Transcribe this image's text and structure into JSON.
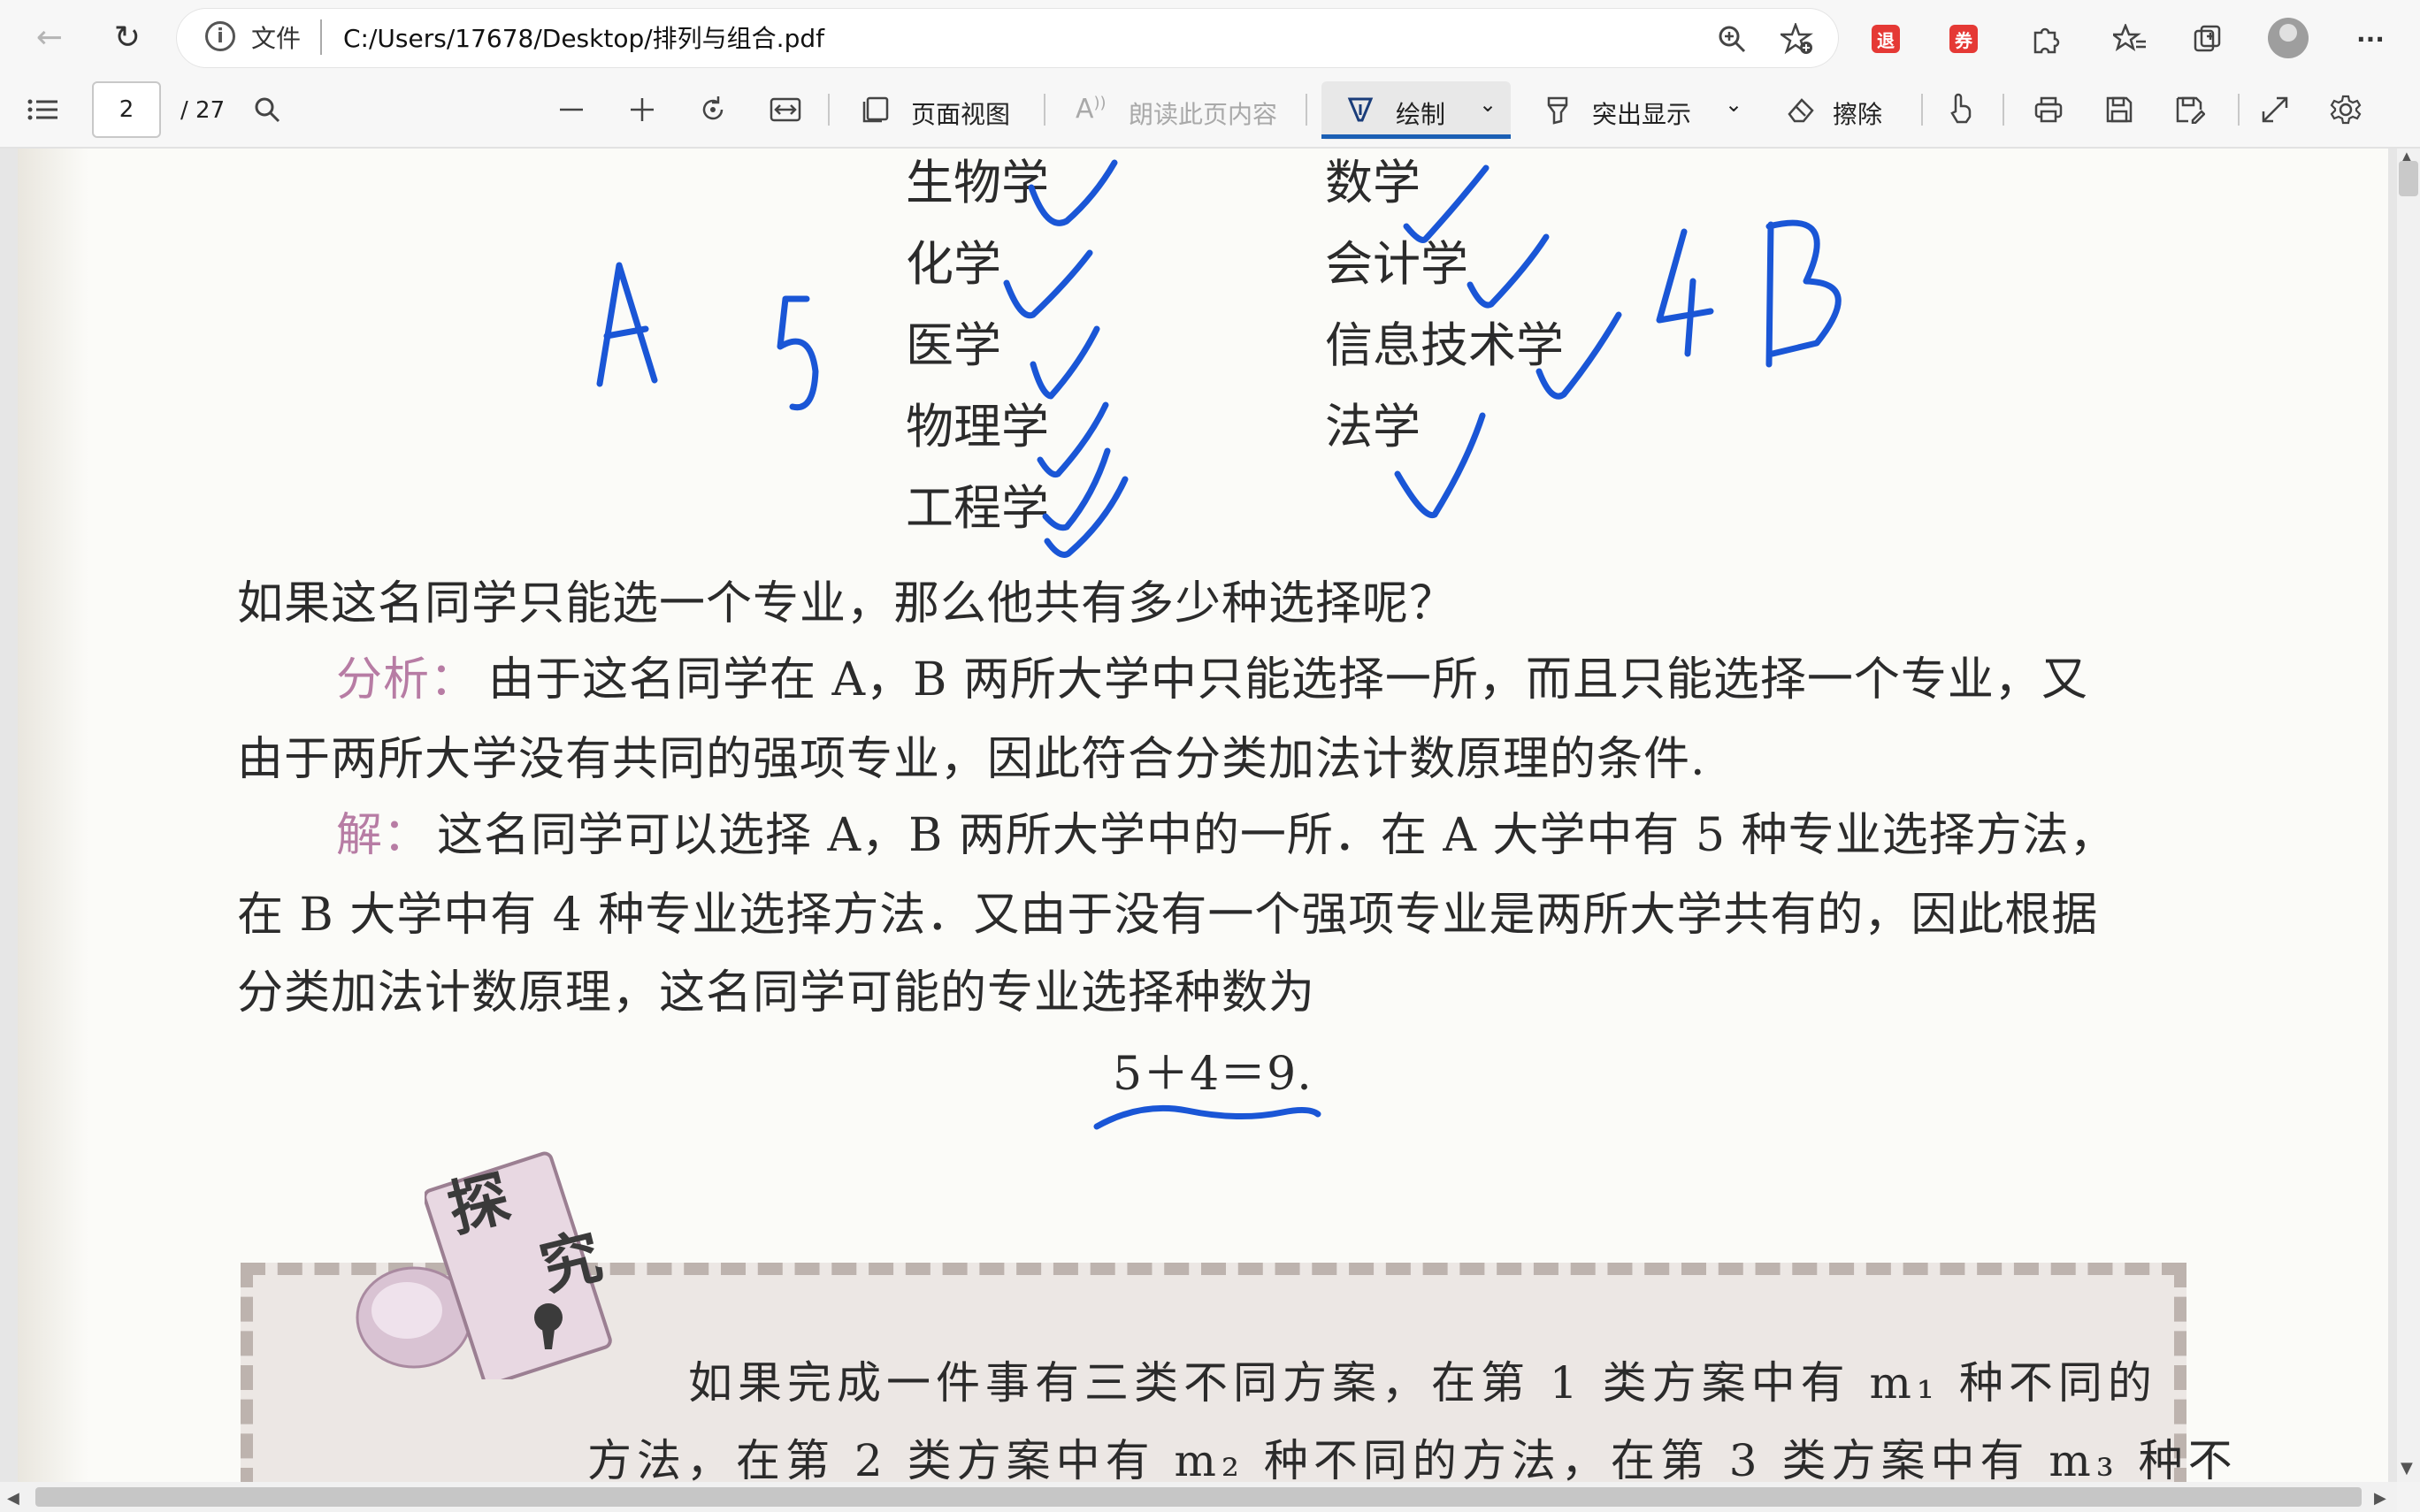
{
  "browser": {
    "file_label": "文件",
    "url": "C:/Users/17678/Desktop/排列与组合.pdf",
    "badge1": "退",
    "badge2": "券",
    "more": "···"
  },
  "pdf_toolbar": {
    "page_current": "2",
    "page_total": "/ 27",
    "page_view_label": "页面视图",
    "read_aloud_label": "朗读此页内容",
    "draw_label": "绘制",
    "highlight_label": "突出显示",
    "erase_label": "擦除"
  },
  "document": {
    "majors_a": [
      "生物学",
      "化学",
      "医学",
      "物理学",
      "工程学"
    ],
    "majors_b": [
      "数学",
      "会计学",
      "信息技术学",
      "法学"
    ],
    "question": "如果这名同学只能选一个专业，那么他共有多少种选择呢？",
    "analysis_label": "分析：",
    "analysis_line1": "由于这名同学在 A，B 两所大学中只能选择一所，而且只能选择一个专业，又",
    "analysis_line2": "由于两所大学没有共同的强项专业，因此符合分类加法计数原理的条件.",
    "solution_label": "解：",
    "solution_line1": "这名同学可以选择 A，B 两所大学中的一所．在 A 大学中有 5 种专业选择方法，",
    "solution_line2": "在 B 大学中有 4 种专业选择方法．又由于没有一个强项专业是两所大学共有的，因此根据",
    "solution_line3": "分类加法计数原理，这名同学可能的专业选择种数为",
    "equation": "5＋4＝9.",
    "explore_title_1": "探",
    "explore_title_2": "究",
    "explore_line1": "如果完成一件事有三类不同方案，在第 1 类方案中有 m₁ 种不同的",
    "explore_line2": "方法，在第 2 类方案中有 m₂ 种不同的方法，在第 3 类方案中有 m₃ 种不"
  },
  "annotations": {
    "ink_color": "#1a56d6",
    "left_letter": "A",
    "left_count": "5",
    "right_count": "4",
    "right_letter": "B"
  }
}
